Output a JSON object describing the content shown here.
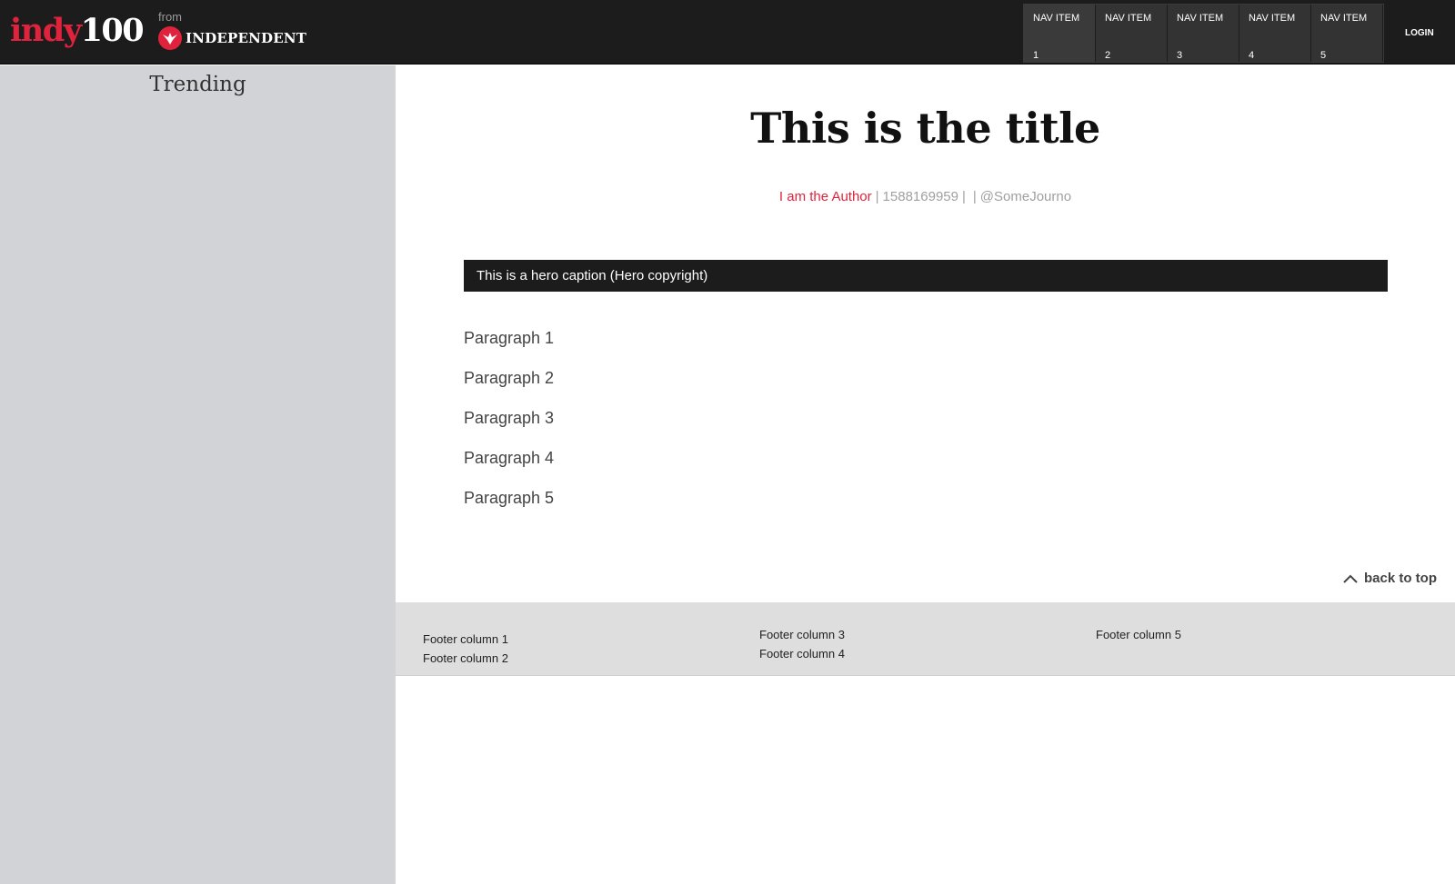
{
  "header": {
    "logo_part1": "indy",
    "logo_part2": "100",
    "from_label": "from",
    "partner_brand": "INDEPENDENT",
    "nav_items": [
      {
        "label": "NAV ITEM",
        "number": "1"
      },
      {
        "label": "NAV ITEM",
        "number": "2"
      },
      {
        "label": "NAV ITEM",
        "number": "3"
      },
      {
        "label": "NAV ITEM",
        "number": "4"
      },
      {
        "label": "NAV ITEM",
        "number": "5"
      }
    ],
    "login_label": "LOGIN"
  },
  "sidebar": {
    "title": "Trending"
  },
  "article": {
    "title": "This is the title",
    "author": "I am the Author",
    "timestamp": "1588169959",
    "twitter": "@SomeJourno",
    "hero_caption": "This is a hero caption (Hero copyright)",
    "paragraphs": [
      "Paragraph 1",
      "Paragraph 2",
      "Paragraph 3",
      "Paragraph 4",
      "Paragraph 5"
    ],
    "back_to_top": "back to top"
  },
  "footer": {
    "columns": [
      "Footer column 1",
      "Footer column 2",
      "Footer column 3",
      "Footer column 4",
      "Footer column 5"
    ]
  },
  "colors": {
    "brand_red": "#e0233c",
    "header_bg": "#1c1c1c",
    "sidebar_bg": "#d1d3d7",
    "footer_bg": "#dedede"
  },
  "icons": {
    "partner_logo": "eagle-icon",
    "back_to_top": "chevron-up-icon"
  }
}
